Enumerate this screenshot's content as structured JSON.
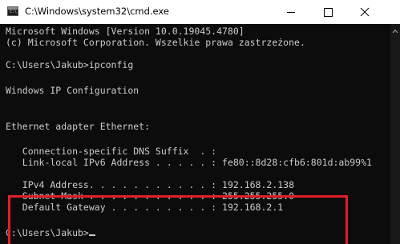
{
  "window": {
    "title": "C:\\Windows\\system32\\cmd.exe",
    "app_icon": "cmd-icon",
    "controls": {
      "minimize": "minimize-icon",
      "maximize": "maximize-icon",
      "close": "close-icon"
    }
  },
  "console": {
    "lines": [
      "Microsoft Windows [Version 10.0.19045.4780]",
      "(c) Microsoft Corporation. Wszelkie prawa zastrzeżone.",
      "",
      "C:\\Users\\Jakub>ipconfig",
      "",
      "Windows IP Configuration",
      "",
      "",
      "Ethernet adapter Ethernet:",
      "",
      "   Connection-specific DNS Suffix  . :",
      "   Link-local IPv6 Address . . . . . : fe80::8d28:cfb6:801d:ab99%1",
      "",
      "   IPv4 Address. . . . . . . . . . . : 192.168.2.138",
      "   Subnet Mask . . . . . . . . . . . : 255.255.255.0",
      "   Default Gateway . . . . . . . . . : 192.168.2.1"
    ],
    "prompt": "C:\\Users\\Jakub>"
  },
  "colors": {
    "console_background": "#0c0c0c",
    "console_text": "#cccccc",
    "highlight": "#e02028",
    "titlebar": "#ffffff"
  }
}
